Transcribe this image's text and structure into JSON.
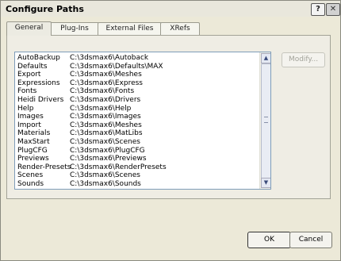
{
  "window": {
    "title": "Configure Paths",
    "help_glyph": "?",
    "close_glyph": "✕"
  },
  "tabs": [
    {
      "label": "General"
    },
    {
      "label": "Plug-Ins"
    },
    {
      "label": "External Files"
    },
    {
      "label": "XRefs"
    }
  ],
  "paths": [
    {
      "name": "AutoBackup",
      "path": "C:\\3dsmax6\\Autoback"
    },
    {
      "name": "Defaults",
      "path": "C:\\3dsmax6\\Defaults\\MAX"
    },
    {
      "name": "Export",
      "path": "C:\\3dsmax6\\Meshes"
    },
    {
      "name": "Expressions",
      "path": "C:\\3dsmax6\\Express"
    },
    {
      "name": "Fonts",
      "path": "C:\\3dsmax6\\Fonts"
    },
    {
      "name": "Heidi Drivers",
      "path": "C:\\3dsmax6\\Drivers"
    },
    {
      "name": "Help",
      "path": "C:\\3dsmax6\\Help"
    },
    {
      "name": "Images",
      "path": "C:\\3dsmax6\\Images"
    },
    {
      "name": "Import",
      "path": "C:\\3dsmax6\\Meshes"
    },
    {
      "name": "Materials",
      "path": "C:\\3dsmax6\\MatLibs"
    },
    {
      "name": "MaxStart",
      "path": "C:\\3dsmax6\\Scenes"
    },
    {
      "name": "PlugCFG",
      "path": "C:\\3dsmax6\\PlugCFG"
    },
    {
      "name": "Previews",
      "path": "C:\\3dsmax6\\Previews"
    },
    {
      "name": "Render-Presets",
      "path": "C:\\3dsmax6\\RenderPresets"
    },
    {
      "name": "Scenes",
      "path": "C:\\3dsmax6\\Scenes"
    },
    {
      "name": "Sounds",
      "path": "C:\\3dsmax6\\Sounds"
    }
  ],
  "buttons": {
    "modify": "Modify...",
    "ok": "OK",
    "cancel": "Cancel"
  },
  "scroll": {
    "up_glyph": "▲",
    "down_glyph": "▼"
  }
}
